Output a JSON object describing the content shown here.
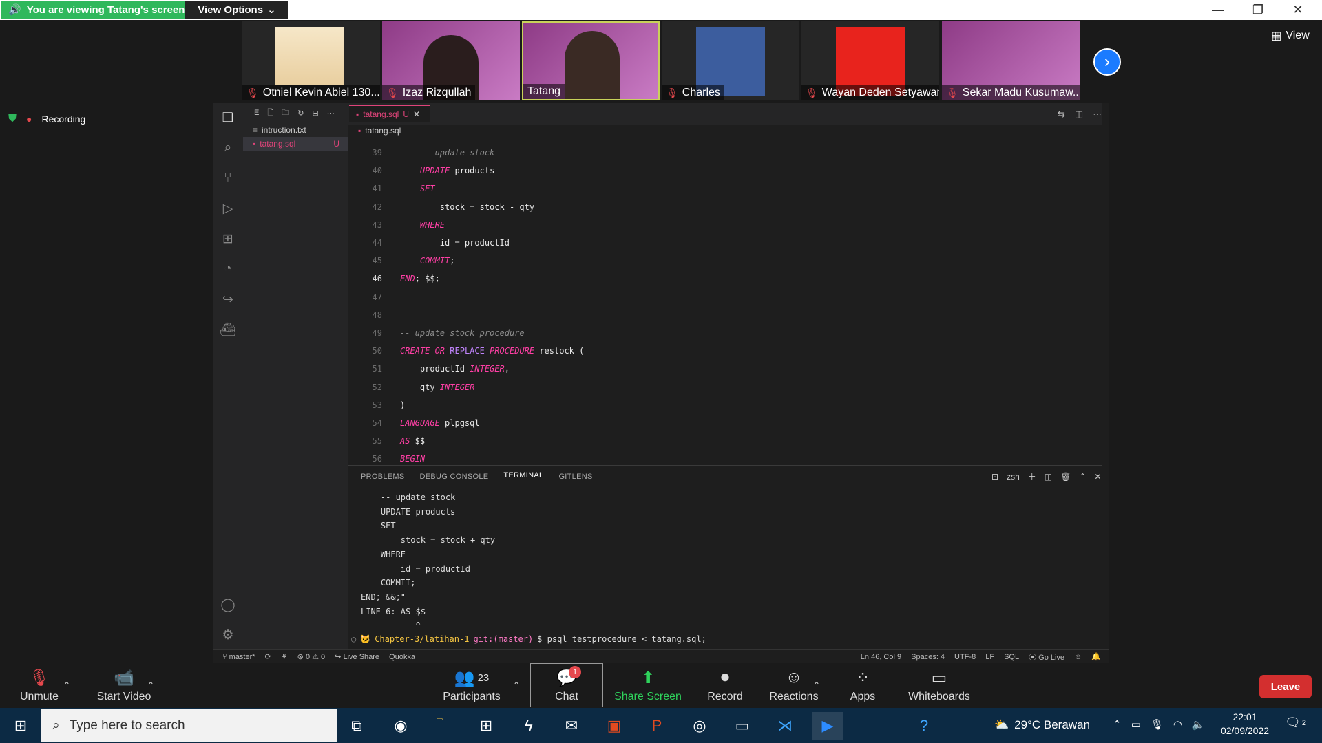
{
  "topbar": {
    "viewing_text": "You are viewing Tatang's screen",
    "view_options": "View Options"
  },
  "participants": [
    {
      "name": "Otniel Kevin Abiel 130...",
      "muted": true
    },
    {
      "name": "Izaz Rizqullah",
      "muted": true
    },
    {
      "name": "Tatang",
      "muted": false
    },
    {
      "name": "Charles",
      "muted": true
    },
    {
      "name": "Wayan Deden Setyawan",
      "muted": true
    },
    {
      "name": "Sekar Madu Kusumaw...",
      "muted": true
    }
  ],
  "view_button": "View",
  "recording_label": "Recording",
  "vscode": {
    "tab_label": "tatang.sql",
    "tab_status": "U",
    "breadcrumb": "tatang.sql",
    "explorer": [
      {
        "name": "intruction.txt",
        "status": ""
      },
      {
        "name": "tatang.sql",
        "status": "U"
      }
    ],
    "explorer_header": "E",
    "code_lines": [
      {
        "num": "39",
        "html": "    <span class='cm'>-- update stock</span>"
      },
      {
        "num": "40",
        "html": "    <span class='kw'>UPDATE</span> products"
      },
      {
        "num": "41",
        "html": "    <span class='kw'>SET</span>"
      },
      {
        "num": "42",
        "html": "        stock = stock - qty"
      },
      {
        "num": "43",
        "html": "    <span class='kw'>WHERE</span>"
      },
      {
        "num": "44",
        "html": "        id = productId"
      },
      {
        "num": "45",
        "html": "    <span class='kw'>COMMIT</span>;"
      },
      {
        "num": "46",
        "html": "<span class='kw'>END</span>; $$;",
        "current": true
      },
      {
        "num": "47",
        "html": ""
      },
      {
        "num": "48",
        "html": ""
      },
      {
        "num": "49",
        "html": "<span class='cm'>-- update stock procedure</span>"
      },
      {
        "num": "50",
        "html": "<span class='kw'>CREATE OR</span> <span class='fn'>REPLACE</span> <span class='kw'>PROCEDURE</span> restock ("
      },
      {
        "num": "51",
        "html": "    productId <span class='ty'>INTEGER</span>,"
      },
      {
        "num": "52",
        "html": "    qty <span class='ty'>INTEGER</span>"
      },
      {
        "num": "53",
        "html": ")"
      },
      {
        "num": "54",
        "html": "<span class='kw'>LANGUAGE</span> plpgsql"
      },
      {
        "num": "55",
        "html": "<span class='kw'>AS</span> $$"
      },
      {
        "num": "56",
        "html": "<span class='kw'>BEGIN</span>"
      }
    ],
    "panel_tabs": [
      "PROBLEMS",
      "DEBUG CONSOLE",
      "TERMINAL",
      "GITLENS"
    ],
    "panel_active": "TERMINAL",
    "shell": "zsh",
    "terminal_lines": [
      "    -- update stock",
      "    UPDATE products",
      "    SET",
      "        stock = stock + qty",
      "    WHERE",
      "        id = productId",
      "    COMMIT;",
      "END; &&;\"",
      "LINE 6: AS $$",
      "           ^"
    ],
    "prompt": {
      "dir": "Chapter-3/latihan-1",
      "git": "git:(master)",
      "cmd": "$ psql testprocedure < tatang.sql;"
    },
    "status": {
      "branch": "master*",
      "errors": "0",
      "warnings": "0",
      "live_share": "Live Share",
      "quokka": "Quokka",
      "position": "Ln 46, Col 9",
      "spaces": "Spaces: 4",
      "encoding": "UTF-8",
      "eol": "LF",
      "lang": "SQL",
      "golive": "Go Live"
    }
  },
  "controls": {
    "unmute": "Unmute",
    "start_video": "Start Video",
    "participants": "Participants",
    "participant_count": "23",
    "chat": "Chat",
    "chat_badge": "1",
    "share": "Share Screen",
    "record": "Record",
    "reactions": "Reactions",
    "apps": "Apps",
    "whiteboards": "Whiteboards",
    "leave": "Leave"
  },
  "taskbar": {
    "search_placeholder": "Type here to search",
    "weather": "29°C  Berawan",
    "time": "22:01",
    "date": "02/09/2022",
    "notif": "2"
  }
}
